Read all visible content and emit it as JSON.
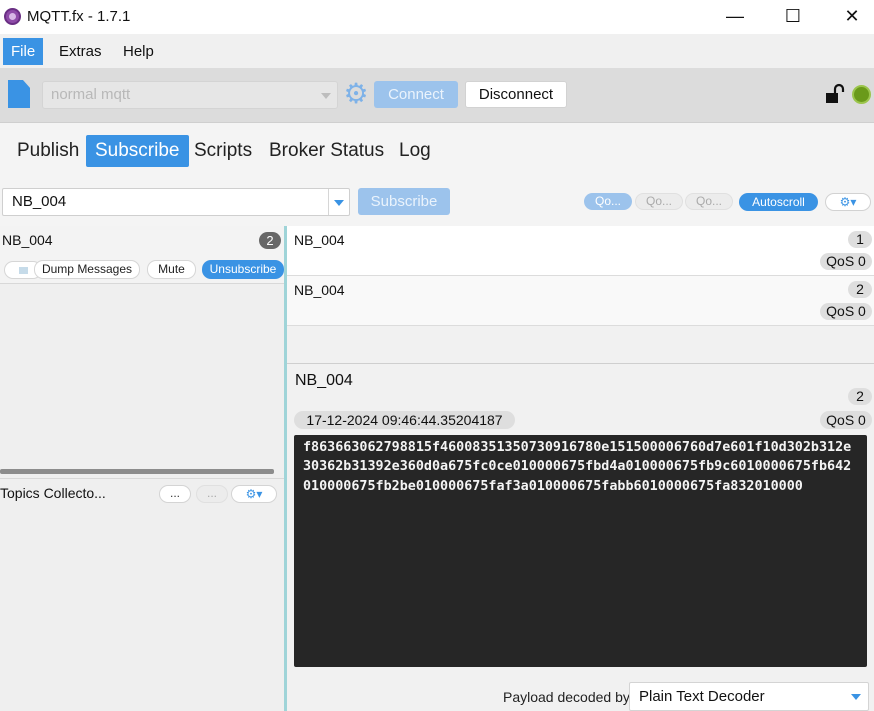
{
  "window": {
    "title": "MQTT.fx - 1.7.1",
    "minimize": "—",
    "maximize": "☐",
    "close": "✕"
  },
  "menu": {
    "items": [
      {
        "label": "File",
        "active": true
      },
      {
        "label": "Extras",
        "active": false
      },
      {
        "label": "Help",
        "active": false
      }
    ]
  },
  "connection": {
    "profile": "normal mqtt",
    "connect_label": "Connect",
    "disconnect_label": "Disconnect",
    "status_color": "#6a9a1a"
  },
  "tabs": [
    {
      "label": "Publish",
      "active": false
    },
    {
      "label": "Subscribe",
      "active": true
    },
    {
      "label": "Scripts",
      "active": false
    },
    {
      "label": "Broker Status",
      "active": false
    },
    {
      "label": "Log",
      "active": false
    }
  ],
  "subscribe_bar": {
    "topic_value": "NB_004",
    "subscribe_label": "Subscribe",
    "qos_buttons": [
      "Qo...",
      "Qo...",
      "Qo..."
    ],
    "autoscroll_label": "Autoscroll",
    "options_icon": "⚙▾"
  },
  "subscriptions": {
    "topic": "NB_004",
    "count": "2",
    "dump_label": "Dump Messages",
    "mute_label": "Mute",
    "unsubscribe_label": "Unsubscribe"
  },
  "topics_collector": {
    "label": "Topics Collecto...",
    "btn1": "...",
    "btn2": "...",
    "options_icon": "⚙▾"
  },
  "messages": [
    {
      "topic": "NB_004",
      "number": "1",
      "qos": "QoS 0"
    },
    {
      "topic": "NB_004",
      "number": "2",
      "qos": "QoS 0"
    }
  ],
  "detail": {
    "topic": "NB_004",
    "number": "2",
    "timestamp": "17-12-2024  09:46:44.35204187",
    "qos": "QoS 0",
    "payload": "f863663062798815f4600835135073091678 0e151500006760d7e601f10d302b312e30362b31392e360d0a675fc0ce010000675fbd4a010000675fb9c6010000675fb642010000675fb2be010000675faf3a010000675fabb6010000675fa832010000",
    "decoder_label": "Payload decoded by",
    "decoder_value": "Plain Text Decoder"
  }
}
